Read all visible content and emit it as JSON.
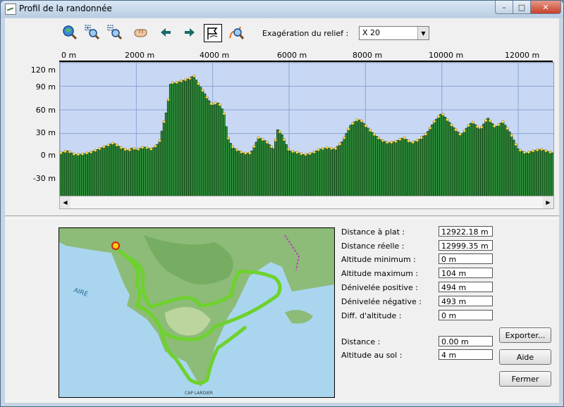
{
  "window": {
    "title": "Profil de la randonnée",
    "minimize": "–",
    "maximize": "□",
    "close": "✕"
  },
  "toolbar": {
    "buttons": [
      {
        "name": "zoom-all-icon"
      },
      {
        "name": "zoom-in-icon"
      },
      {
        "name": "zoom-out-icon"
      },
      {
        "name": "pan-hand-icon"
      },
      {
        "name": "arrow-left-icon"
      },
      {
        "name": "arrow-right-icon"
      },
      {
        "name": "show-path-icon"
      },
      {
        "name": "zoom-path-icon"
      }
    ],
    "relief_label": "Exagération du relief :",
    "relief_value": "X 20"
  },
  "chart_data": {
    "type": "bar",
    "x_ticks": [
      "0 m",
      "2000 m",
      "4000 m",
      "6000 m",
      "8000 m",
      "10000 m",
      "12000 m"
    ],
    "y_ticks": [
      "120 m",
      "90 m",
      "60 m",
      "30 m",
      "0 m",
      "-30 m"
    ],
    "xlim": [
      0,
      12922
    ],
    "ylim": [
      -50,
      120
    ],
    "grid": true,
    "profile": [
      [
        0,
        5
      ],
      [
        200,
        8
      ],
      [
        400,
        3
      ],
      [
        600,
        4
      ],
      [
        800,
        6
      ],
      [
        1000,
        10
      ],
      [
        1200,
        14
      ],
      [
        1400,
        18
      ],
      [
        1600,
        12
      ],
      [
        1800,
        8
      ],
      [
        1900,
        12
      ],
      [
        2000,
        9
      ],
      [
        2200,
        13
      ],
      [
        2400,
        10
      ],
      [
        2600,
        18
      ],
      [
        2700,
        40
      ],
      [
        2800,
        60
      ],
      [
        2900,
        95
      ],
      [
        3000,
        94
      ],
      [
        3200,
        97
      ],
      [
        3400,
        100
      ],
      [
        3500,
        104
      ],
      [
        3600,
        95
      ],
      [
        3800,
        80
      ],
      [
        3900,
        72
      ],
      [
        4000,
        65
      ],
      [
        4100,
        70
      ],
      [
        4200,
        66
      ],
      [
        4300,
        55
      ],
      [
        4400,
        25
      ],
      [
        4500,
        14
      ],
      [
        4600,
        10
      ],
      [
        4800,
        5
      ],
      [
        5000,
        5
      ],
      [
        5200,
        25
      ],
      [
        5400,
        20
      ],
      [
        5600,
        10
      ],
      [
        5700,
        35
      ],
      [
        5800,
        30
      ],
      [
        6000,
        8
      ],
      [
        6200,
        6
      ],
      [
        6400,
        3
      ],
      [
        6600,
        5
      ],
      [
        6800,
        10
      ],
      [
        7000,
        12
      ],
      [
        7200,
        10
      ],
      [
        7400,
        20
      ],
      [
        7600,
        40
      ],
      [
        7800,
        48
      ],
      [
        7900,
        46
      ],
      [
        8000,
        40
      ],
      [
        8200,
        30
      ],
      [
        8400,
        22
      ],
      [
        8600,
        18
      ],
      [
        8800,
        20
      ],
      [
        9000,
        25
      ],
      [
        9200,
        18
      ],
      [
        9400,
        22
      ],
      [
        9600,
        30
      ],
      [
        9800,
        45
      ],
      [
        10000,
        56
      ],
      [
        10100,
        50
      ],
      [
        10300,
        38
      ],
      [
        10500,
        28
      ],
      [
        10700,
        40
      ],
      [
        10800,
        45
      ],
      [
        11000,
        35
      ],
      [
        11200,
        50
      ],
      [
        11400,
        38
      ],
      [
        11600,
        45
      ],
      [
        11800,
        30
      ],
      [
        12000,
        10
      ],
      [
        12200,
        5
      ],
      [
        12400,
        8
      ],
      [
        12600,
        10
      ],
      [
        12922,
        5
      ]
    ]
  },
  "stats": [
    {
      "label": "Distance à plat :",
      "value": "12922.18 m"
    },
    {
      "label": "Distance réelle :",
      "value": "12999.35 m"
    },
    {
      "label": "Altitude minimum :",
      "value": "0 m"
    },
    {
      "label": "Altitude maximum :",
      "value": "104 m"
    },
    {
      "label": "Dénivelée positive :",
      "value": "494 m"
    },
    {
      "label": "Dénivelée négative :",
      "value": "493 m"
    },
    {
      "label": "Diff. d'altitude :",
      "value": "0 m"
    }
  ],
  "cursor": [
    {
      "label": "Distance :",
      "value": "0.00 m"
    },
    {
      "label": "Altitude au sol :",
      "value": "4 m"
    }
  ],
  "buttons": {
    "export": "Exporter...",
    "help": "Aide",
    "close": "Fermer"
  },
  "map": {
    "labels": [
      "AIRE",
      "CAP LARDIER"
    ]
  }
}
